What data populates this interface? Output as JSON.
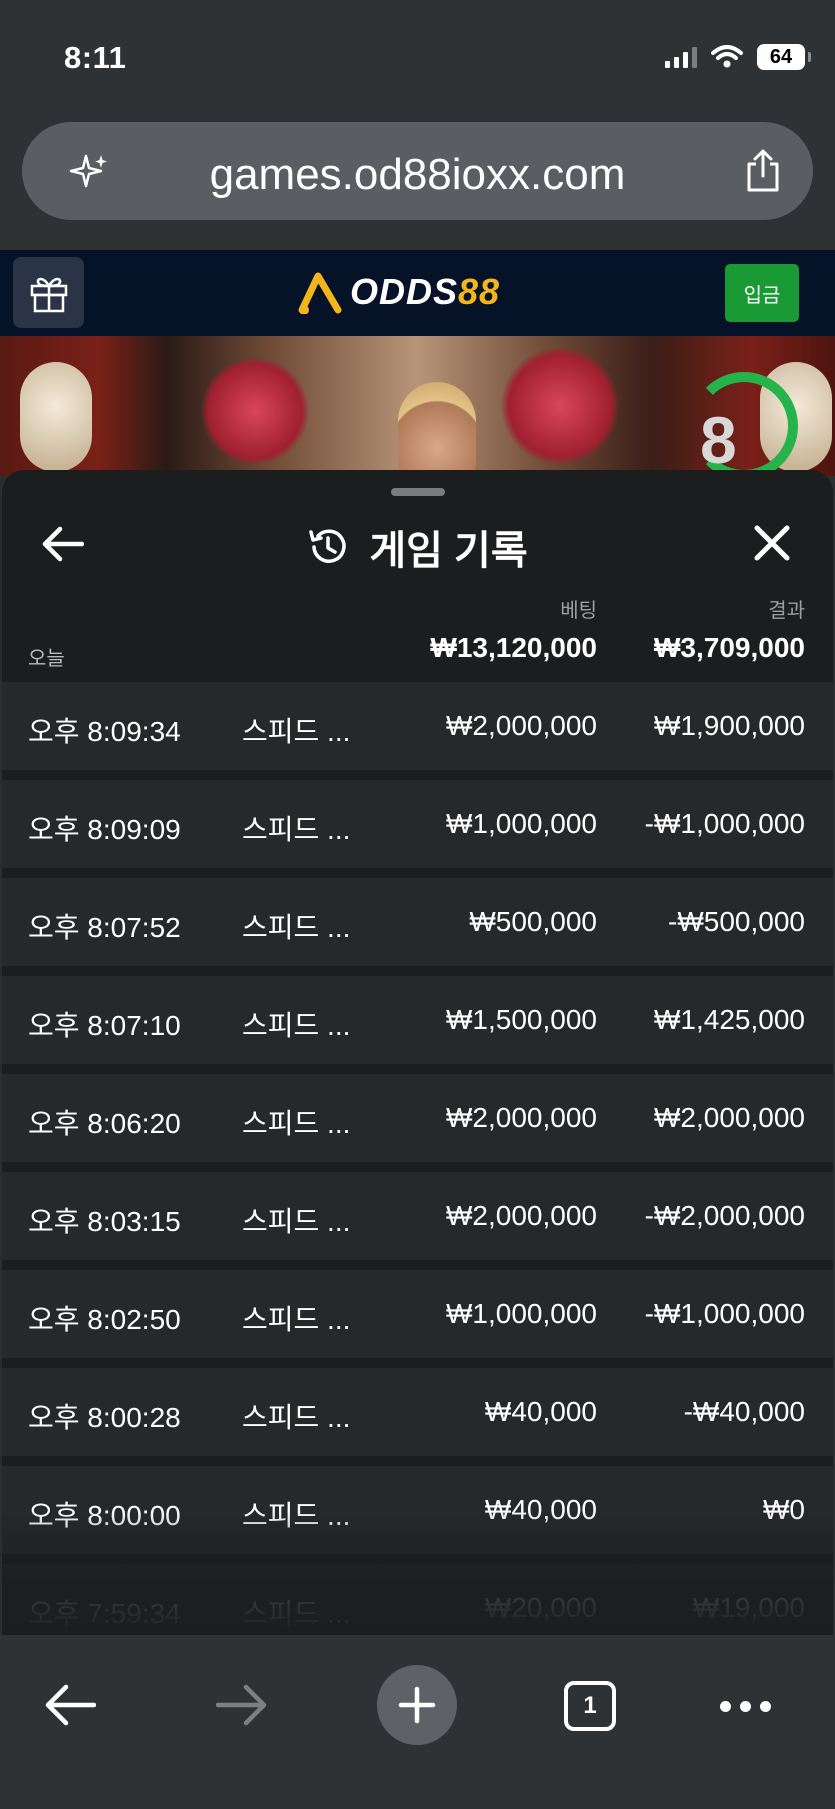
{
  "status": {
    "time": "8:11",
    "battery": "64"
  },
  "browser": {
    "url": "games.od88ioxx.com",
    "tab_count": "1"
  },
  "site": {
    "logo_text": "ODDS",
    "logo_num": "88",
    "deposit_label": "입금",
    "timer": "8"
  },
  "sheet": {
    "title": "게임 기록",
    "col_bet": "베팅",
    "col_result": "결과",
    "today_label": "오늘",
    "total_bet": "₩13,120,000",
    "total_result": "₩3,709,000",
    "rows": [
      {
        "time": "오후 8:09:34",
        "game": "스피드 ...",
        "bet": "₩2,000,000",
        "result": "₩1,900,000"
      },
      {
        "time": "오후 8:09:09",
        "game": "스피드 ...",
        "bet": "₩1,000,000",
        "result": "-₩1,000,000"
      },
      {
        "time": "오후 8:07:52",
        "game": "스피드 ...",
        "bet": "₩500,000",
        "result": "-₩500,000"
      },
      {
        "time": "오후 8:07:10",
        "game": "스피드 ...",
        "bet": "₩1,500,000",
        "result": "₩1,425,000"
      },
      {
        "time": "오후 8:06:20",
        "game": "스피드 ...",
        "bet": "₩2,000,000",
        "result": "₩2,000,000"
      },
      {
        "time": "오후 8:03:15",
        "game": "스피드 ...",
        "bet": "₩2,000,000",
        "result": "-₩2,000,000"
      },
      {
        "time": "오후 8:02:50",
        "game": "스피드 ...",
        "bet": "₩1,000,000",
        "result": "-₩1,000,000"
      },
      {
        "time": "오후 8:00:28",
        "game": "스피드 ...",
        "bet": "₩40,000",
        "result": "-₩40,000"
      },
      {
        "time": "오후 8:00:00",
        "game": "스피드 ...",
        "bet": "₩40,000",
        "result": "₩0"
      },
      {
        "time": "오후 7:59:34",
        "game": "스피드 ...",
        "bet": "₩20,000",
        "result": "₩19,000"
      }
    ]
  },
  "colors": {
    "accent_green": "#1a9a35",
    "logo_gold": "#f2b51c",
    "sheet_bg": "#1c1d1f",
    "row_bg": "#27282a"
  },
  "icons": [
    "sparkle-icon",
    "share-icon",
    "gift-icon",
    "back-arrow-icon",
    "history-icon",
    "close-icon",
    "forward-arrow-icon",
    "plus-icon",
    "more-icon"
  ]
}
